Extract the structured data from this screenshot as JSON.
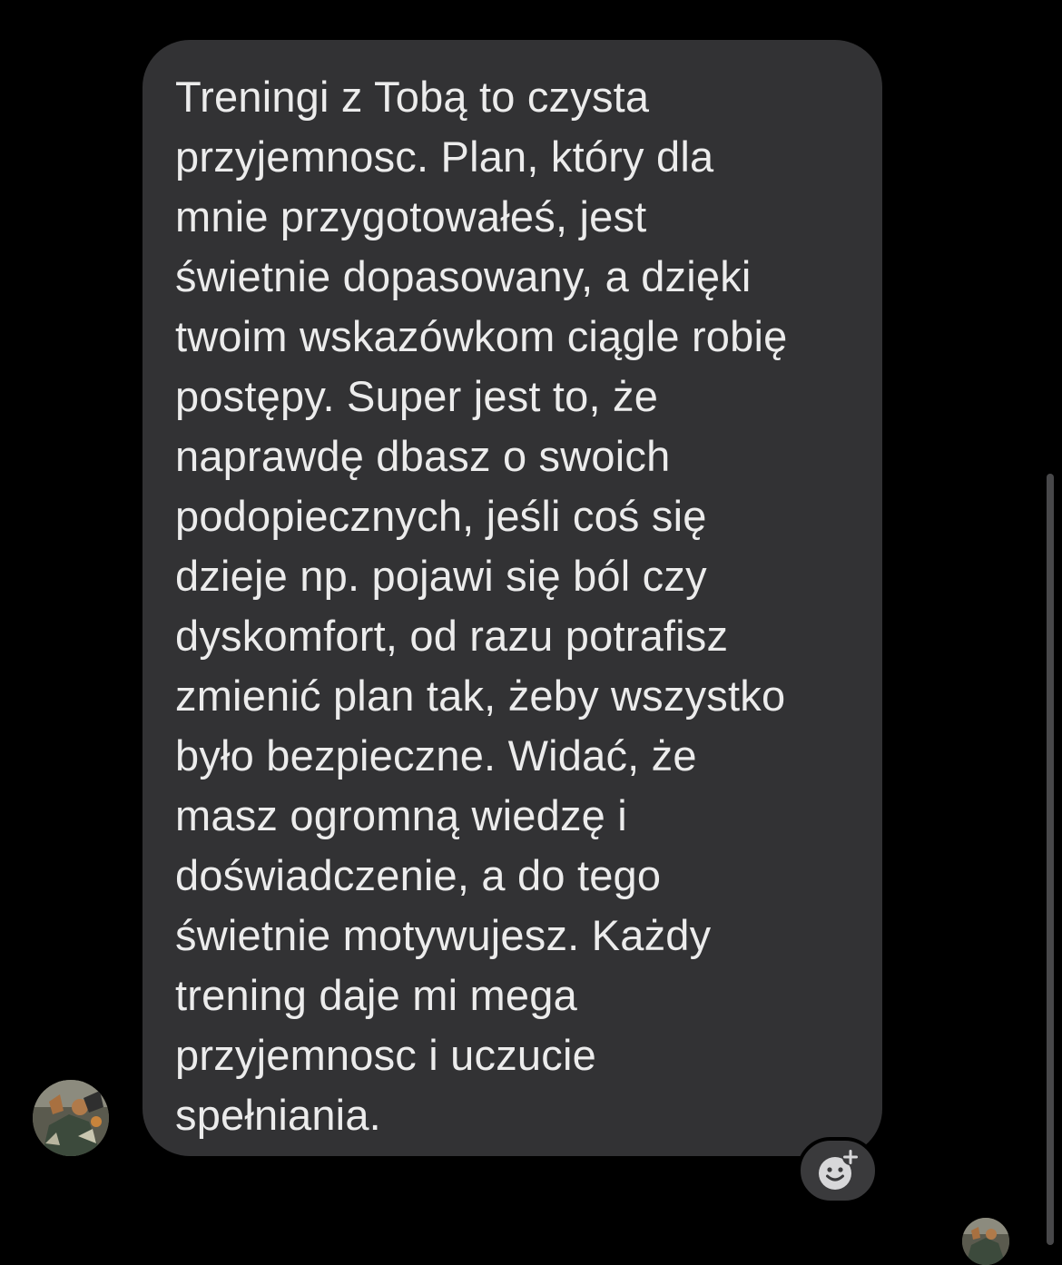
{
  "conversation": {
    "message": {
      "text": "Treningi z Tobą to czysta\nprzyjemnosc. Plan, który dla\nmnie przygotowałeś, jest\nświetnie dopasowany, a dzięki\ntwoim wskazówkom ciągle robię\npostępy. Super jest to, że\nnaprawdę dbasz o swoich\npodopiecznych, jeśli coś się\ndzieje np. pojawi się ból czy\ndyskomfort, od razu potrafisz\nzmienić plan tak, żeby wszystko\nbyło bezpieczne. Widać, że\nmasz ogromną wiedzę i\ndoświadczenie, a do tego\nświetnie motywujesz. Każdy\ntrening daje mi mega\nprzyjemnosc i uczucie\nspełniania."
    },
    "sender_avatar_icon": "user-photo-icon",
    "read_receipt_avatar_icon": "user-photo-icon",
    "react_button_icon": "add-reaction-icon"
  },
  "colors": {
    "background": "#000000",
    "bubble": "#323234",
    "text": "#ececec",
    "react_button_bg": "#3a3a3c",
    "icon": "#d7d7d9"
  }
}
